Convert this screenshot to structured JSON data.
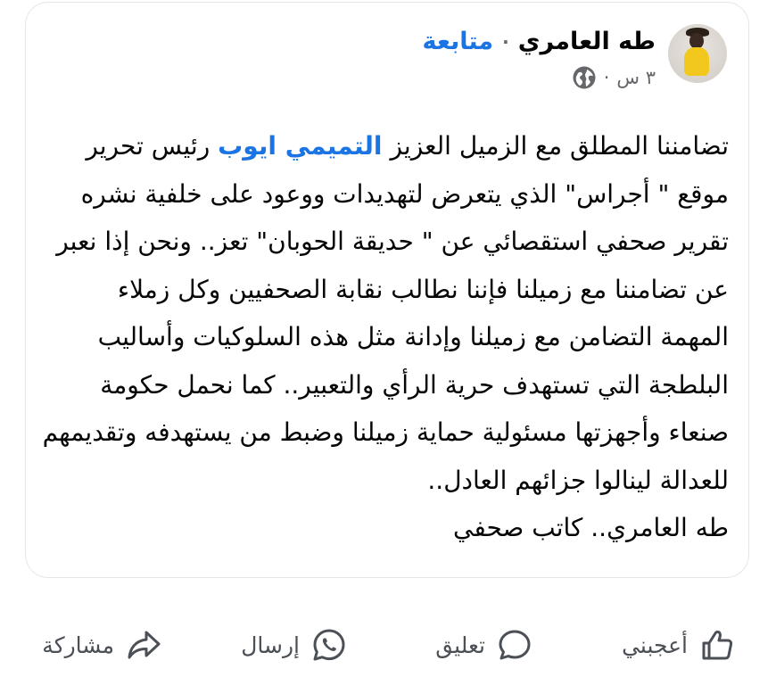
{
  "post": {
    "author": "طه العامري",
    "separator": "·",
    "follow_label": "متابعة",
    "time": "٣ س",
    "time_separator": "·",
    "privacy_icon": "globe-icon",
    "body": {
      "line1_a": "تضامننا المطلق مع الزميل العزيز ",
      "mention": "التميمي ايوب",
      "line1_b": " رئيس تحرير",
      "rest": "موقع \" أجراس\" الذي يتعرض لتهديدات ووعود على خلفية نشره تقرير صحفي استقصائي عن \" حديقة الحوبان\" تعز.. ونحن إذا نعبر عن تضامننا مع زميلنا فإننا نطالب نقابة الصحفيين وكل زملاء المهمة التضامن مع زميلنا وإدانة مثل هذه السلوكيات وأساليب البلطجة التي تستهدف حرية الرأي والتعبير.. كما نحمل حكومة صنعاء وأجهزتها مسئولية حماية زميلنا وضبط من يستهدفه وتقديمهم للعدالة لينالوا جزائهم العادل..",
      "signature": "طه العامري.. كاتب صحفي"
    }
  },
  "actions": {
    "like": "أعجبني",
    "comment": "تعليق",
    "send": "إرسال",
    "share": "مشاركة"
  },
  "colors": {
    "accent": "#1b74e4",
    "text": "#050505",
    "muted": "#65676b",
    "border": "#e4e6eb"
  }
}
